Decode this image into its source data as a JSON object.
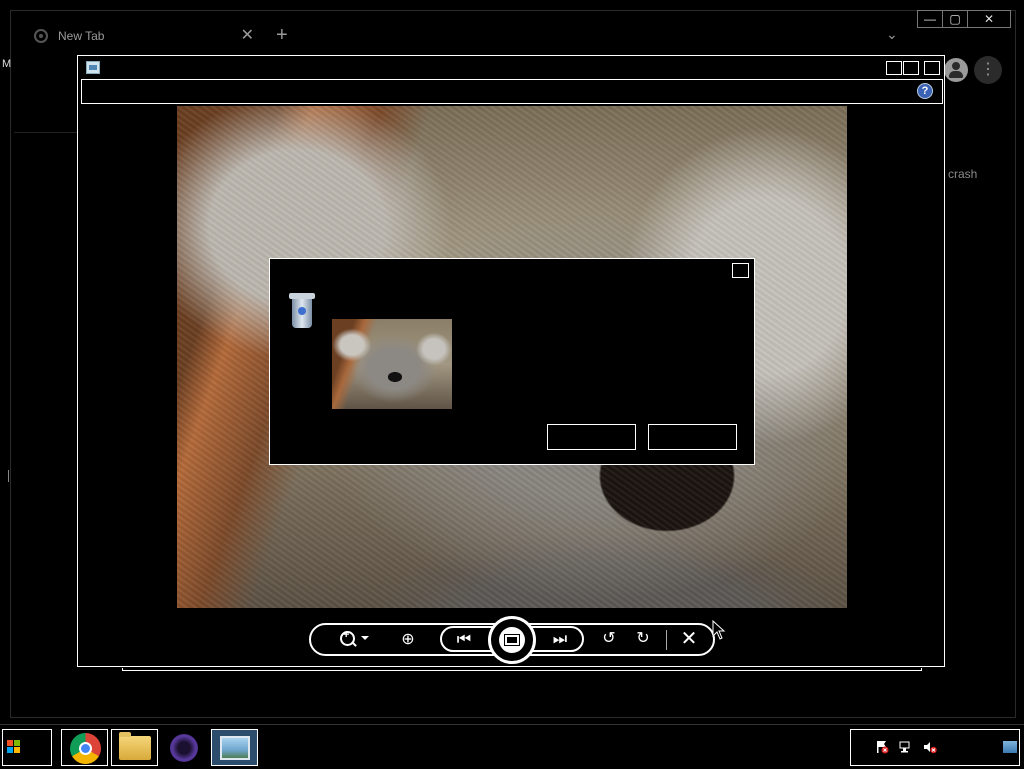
{
  "browser": {
    "tab_title": "New Tab",
    "tab_close": "✕",
    "new_tab": "+",
    "tab_list": "⌄",
    "minimize": "—",
    "maximize": "▢",
    "close": "✕",
    "menu": "⋮",
    "side_letter": "M",
    "page_text_fragment": "crash"
  },
  "viewer": {
    "help": "?",
    "controls": {
      "fit": "⊕",
      "previous": "⏮",
      "next": "⏭",
      "rotate_left": "↺",
      "rotate_right": "↻",
      "delete": "✕"
    }
  },
  "dialog": {
    "yes_label": "",
    "no_label": ""
  },
  "colors": {
    "background": "#000000",
    "outline": "#ffffff",
    "win_red": "#f25022",
    "win_green": "#7fba00",
    "win_blue": "#00a4ef",
    "win_yellow": "#ffb900"
  }
}
